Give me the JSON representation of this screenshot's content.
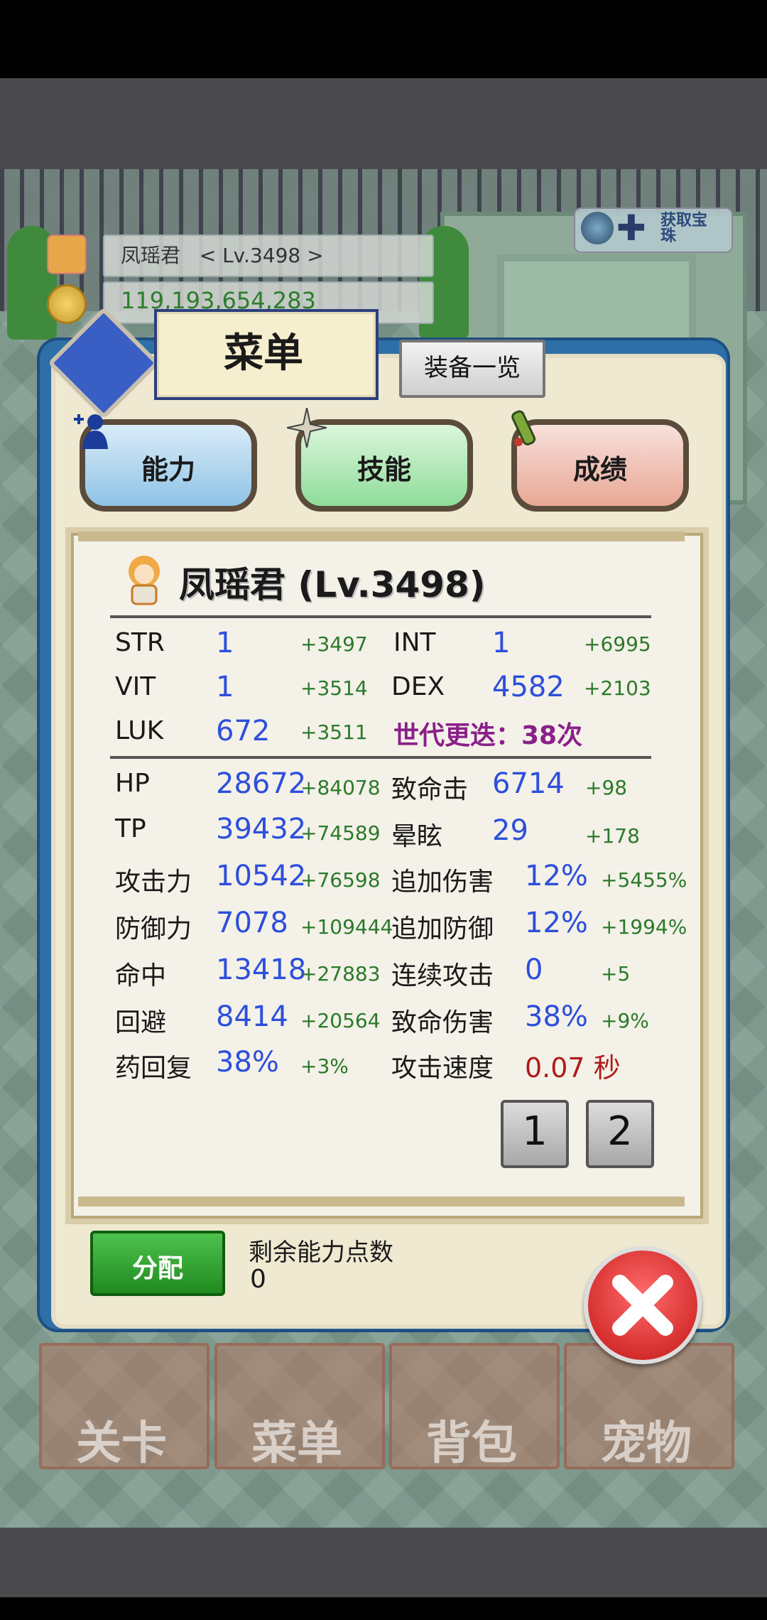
{
  "top_info": {
    "hero_name_level": "凤瑶君   < Lv.3498 >",
    "gold": "119,193,654,283",
    "get_gems_label": "获取宝珠"
  },
  "menu": {
    "title": "菜单",
    "equip_list_label": "装备一览"
  },
  "tabs": [
    {
      "label": "能力"
    },
    {
      "label": "技能"
    },
    {
      "label": "成绩"
    }
  ],
  "hero": {
    "title": "凤瑶君 (Lv.3498)"
  },
  "base_stats": [
    {
      "label": "STR",
      "value": "1",
      "bonus": "+3497"
    },
    {
      "label": "INT",
      "value": "1",
      "bonus": "+6995"
    },
    {
      "label": "VIT",
      "value": "1",
      "bonus": "+3514"
    },
    {
      "label": "DEX",
      "value": "4582",
      "bonus": "+2103"
    },
    {
      "label": "LUK",
      "value": "672",
      "bonus": "+3511"
    }
  ],
  "generation_text": "世代更迭：38次",
  "left_stats": [
    {
      "label": "HP",
      "value": "28672",
      "bonus": "+84078"
    },
    {
      "label": "TP",
      "value": "39432",
      "bonus": "+74589"
    },
    {
      "label": "攻击力",
      "value": "10542",
      "bonus": "+76598"
    },
    {
      "label": "防御力",
      "value": "7078",
      "bonus": "+109444"
    },
    {
      "label": "命中",
      "value": "13418",
      "bonus": "+27883"
    },
    {
      "label": "回避",
      "value": "8414",
      "bonus": "+20564"
    },
    {
      "label": "药回复",
      "value": "38%",
      "bonus": "+3%"
    }
  ],
  "right_stats": [
    {
      "label": "致命击",
      "value": "6714",
      "bonus": "+98"
    },
    {
      "label": "晕眩",
      "value": "29",
      "bonus": "+178"
    },
    {
      "label": "追加伤害",
      "value": "12%",
      "bonus": "+5455%"
    },
    {
      "label": "追加防御",
      "value": "12%",
      "bonus": "+1994%"
    },
    {
      "label": "连续攻击",
      "value": "0",
      "bonus": "+5"
    },
    {
      "label": "致命伤害",
      "value": "38%",
      "bonus": "+9%"
    },
    {
      "label": "攻击速度",
      "value": "0.07 秒"
    }
  ],
  "pages": [
    "1",
    "2"
  ],
  "allocation": {
    "button_label": "分配",
    "remaining_label": "剩余能力点数",
    "remaining_value": "0"
  },
  "nav": [
    {
      "label": "关卡"
    },
    {
      "label": "菜单"
    },
    {
      "label": "背包"
    },
    {
      "label": "宠物"
    }
  ]
}
